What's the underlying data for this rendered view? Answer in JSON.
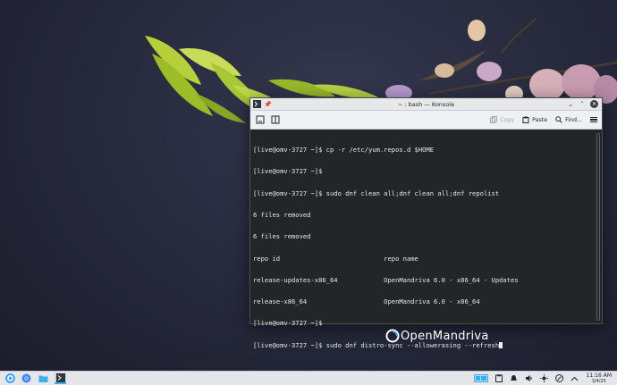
{
  "window": {
    "title": "~ : bash — Konsole"
  },
  "toolbar": {
    "copy_label": "Copy",
    "paste_label": "Paste",
    "find_label": "Find..."
  },
  "terminal": {
    "lines": [
      "[live@omv-3727 ~]$ cp -r /etc/yum.repos.d $HOME",
      "[live@omv-3727 ~]$",
      "[live@omv-3727 ~]$ sudo dnf clean all;dnf clean all;dnf repolist",
      "6 files removed",
      "6 files removed",
      "repo id                           repo name",
      "release-updates-x86_64            OpenMandriva 6.0 - x86_64 - Updates",
      "release-x86_64                    OpenMandriva 6.0 - x86_64",
      "[live@omv-3727 ~]$",
      "[live@omv-3727 ~]$ sudo dnf distro-sync --allowerasing --refresh"
    ]
  },
  "desktop": {
    "logo_text": "OpenMandriva"
  },
  "taskbar": {
    "clock_time": "11:16 AM",
    "clock_date": "3/4/25"
  },
  "colors": {
    "accent": "#3daee9",
    "terminal_bg": "#232627",
    "terminal_fg": "#e6e8e9"
  }
}
